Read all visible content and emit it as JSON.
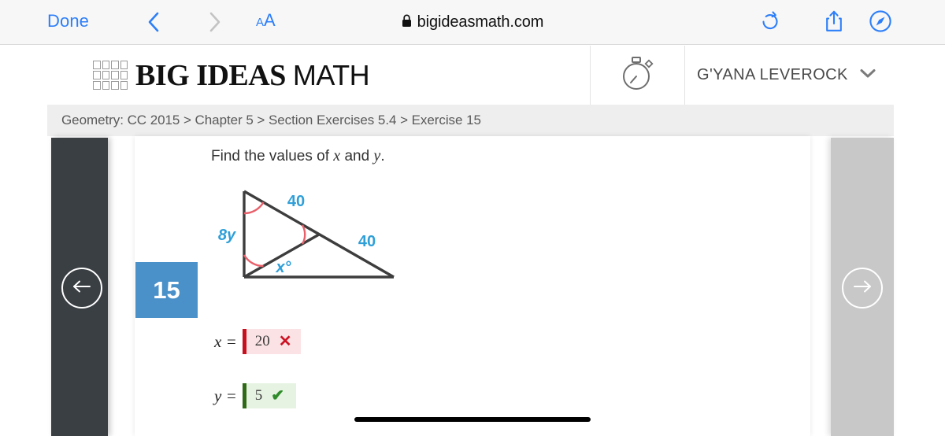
{
  "browser": {
    "done_label": "Done",
    "back_icon": "chevron-left-icon",
    "forward_icon": "chevron-right-icon",
    "text_size_label_small": "A",
    "text_size_label_large": "A",
    "lock_icon": "lock-icon",
    "url": "bigideasmath.com",
    "reload_icon": "reload-icon",
    "share_icon": "share-icon",
    "compass_icon": "compass-icon"
  },
  "site_header": {
    "logo_icon": "grid-logo-icon",
    "logo_bold": "BIG IDEAS",
    "logo_thin": "MATH",
    "timer_icon": "stopwatch-icon",
    "user_name": "G'YANA LEVEROCK",
    "user_chevron_icon": "chevron-down-icon"
  },
  "breadcrumb": {
    "text": "Geometry: CC 2015 > Chapter 5 > Section Exercises 5.4 > Exercise 15"
  },
  "navigation": {
    "prev_icon": "arrow-left-icon",
    "next_icon": "arrow-right-icon"
  },
  "exercise": {
    "number": "15",
    "question_prefix": "Find the values of",
    "question_var1": "x",
    "question_conjunction": "and",
    "question_var2": "y",
    "question_suffix": "."
  },
  "diagram": {
    "label_8y": "8y",
    "label_top_40": "40",
    "label_right_40": "40",
    "label_x_angle": "x°",
    "line_color": "#3d3d3d",
    "label_color": "#2f9fd8",
    "arc_color": "#e8606a"
  },
  "answers": [
    {
      "label": "x =",
      "value": "20",
      "status": "wrong",
      "mark": "✕",
      "box_bg": "#fbe3e5",
      "accent": "#c80f1e"
    },
    {
      "label": "y =",
      "value": "5",
      "status": "right",
      "mark": "✔",
      "box_bg": "#e7f3e2",
      "accent": "#2f6b16"
    }
  ],
  "system": {
    "home_indicator": "home-indicator"
  }
}
